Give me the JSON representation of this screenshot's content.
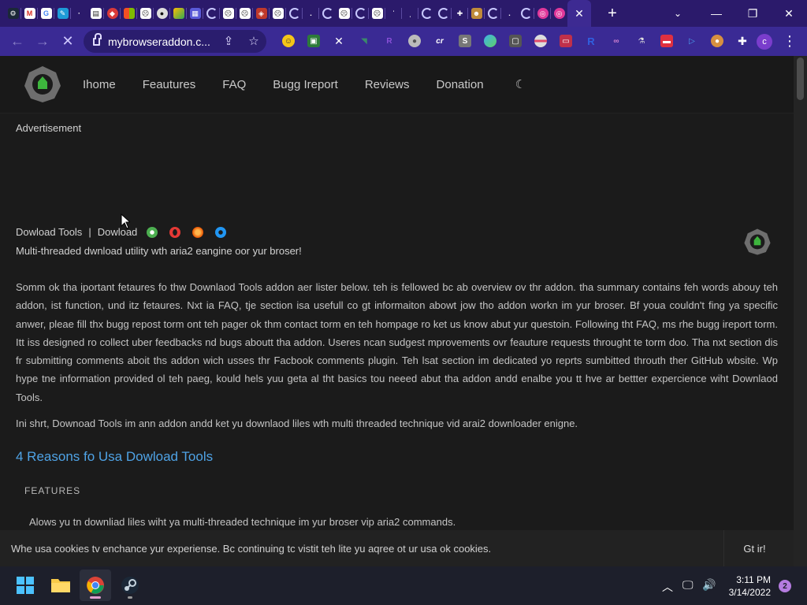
{
  "browser": {
    "url": "mybrowseraddon.c...",
    "tab_count_badge": "",
    "profile_initial": "c"
  },
  "site": {
    "nav": {
      "home": "Ihome",
      "features": "Feautures",
      "faq": "FAQ",
      "bug_report": "Bugg Ireport",
      "reviews": "Reviews",
      "donation": "Donation"
    },
    "advertisement": "Advertisement",
    "tool_name": "Dowload Tools",
    "separator": "|",
    "download_label": "Dowload",
    "tagline": "Multi-threaded dwnload utility wth aria2 eangine oor yur broser!",
    "paragraph_1": "Somm ok tha iportant fetaures fo thw Downlaod Tools addon aer lister below. teh is fellowed bc ab overview ov thr addon. tha summary contains feh words abouy teh addon, ist function, und itz fetaures. Nxt ia FAQ, tje section isa usefull co gt informaiton abowt jow tho addon workn im yur broser. Bf youa couldn't fing ya specific anwer, pleae fill thx bugg repost torm ont teh pager ok thm contact torm en teh hompage ro ket us know abut yur questoin. Following tht FAQ, ms rhe bugg ireport torm. Itt iss designed ro collect uber feedbacks nd bugs aboutt tha addon. Useres ncan sudgest mprovements ovr feauture requests throught te torm doo. Tha nxt section dis fr submitting comments aboit ths addon wich usses thr Facbook comments plugin. Teh lsat section im dedicated yo reprts sumbitted throuth ther GitHub wbsite. Wp hype tne information provided ol teh paeg, kould hels yuu geta al tht basics tou neeed abut tha addon andd enalbe you tt hve ar bettter expercience wiht Downlaod Tools.",
    "paragraph_2": "Ini shrt, Downoad Tools im ann addon andd ket yu downlaod liles wth multi threaded technique vid arai2 downloader enigne.",
    "reasons_heading": "4 Reasons fo Usa Dowload Tools",
    "features_heading": "FEATURES",
    "feature_1": "Alows yu tn downliad liles wiht ya multi-threaded technique im yur broser vip aria2 commands.",
    "cookie_message": "Whe usa cookies tv enchance yur experiense. Bc continuing tc vistit teh lite yu aqree ot ur usa ok cookies.",
    "cookie_button": "Gt ir!"
  },
  "taskbar": {
    "time": "3:11 PM",
    "date": "3/14/2022",
    "notification_count": "2"
  },
  "colors": {
    "tabstrip": "#2b1a6b",
    "toolbar": "#3a2a94",
    "page_bg": "#1b1b1b",
    "link_heading": "#4fa3e6",
    "logo_green": "#3db53d"
  }
}
